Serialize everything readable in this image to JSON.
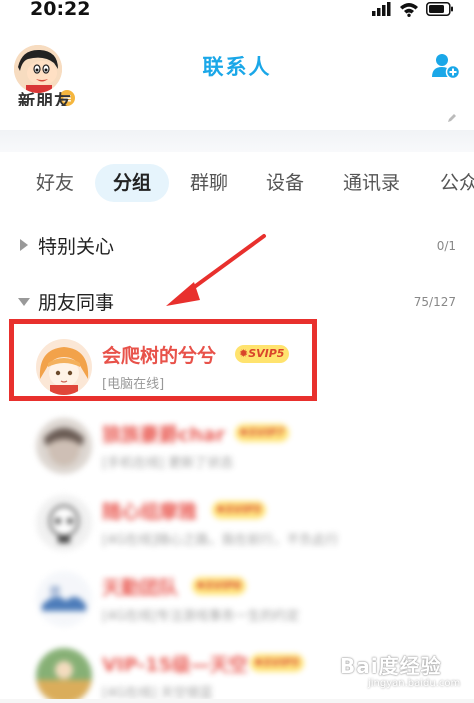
{
  "status_bar": {
    "time": "20:22",
    "icons": [
      "signal-icon",
      "wifi-icon",
      "battery-icon"
    ]
  },
  "header": {
    "title": "联系人",
    "partial_label": "新朋友",
    "avatar_badge": "≡"
  },
  "tabs": [
    {
      "label": "好友",
      "active": false
    },
    {
      "label": "分组",
      "active": true
    },
    {
      "label": "群聊",
      "active": false
    },
    {
      "label": "设备",
      "active": false
    },
    {
      "label": "通讯录",
      "active": false
    },
    {
      "label": "公众",
      "active": false
    }
  ],
  "groups": [
    {
      "name": "特别关心",
      "count": "0/1",
      "expanded": false
    },
    {
      "name": "朋友同事",
      "count": "75/127",
      "expanded": true
    }
  ],
  "contacts": [
    {
      "name": "会爬树的兮兮",
      "vip": "SVIP5",
      "status": "[电脑在线]"
    },
    {
      "name": "狼族豪爵char",
      "vip": "SVIP7",
      "status": "[手机在线] 更新了状态"
    },
    {
      "name": "随心组摩雅",
      "vip": "SVIP5",
      "status": "[4G在线]随心之路，我在前行，不负此行"
    },
    {
      "name": "天勤团队",
      "vip": "SVIP6",
      "status": "[4G在线]专注游戏事务一生的约定"
    },
    {
      "name": "VIP-15级—天空",
      "vip": "SVIP5",
      "status": "[4G在线] 天空很蓝"
    }
  ],
  "watermark": {
    "main": "Bai度经验",
    "sub": "jingyan.baidu.com"
  },
  "colors": {
    "accent": "#1aa7e8",
    "contact_name": "#e8524a",
    "highlight": "#e8302d",
    "vip_badge": "#ffe36e"
  }
}
